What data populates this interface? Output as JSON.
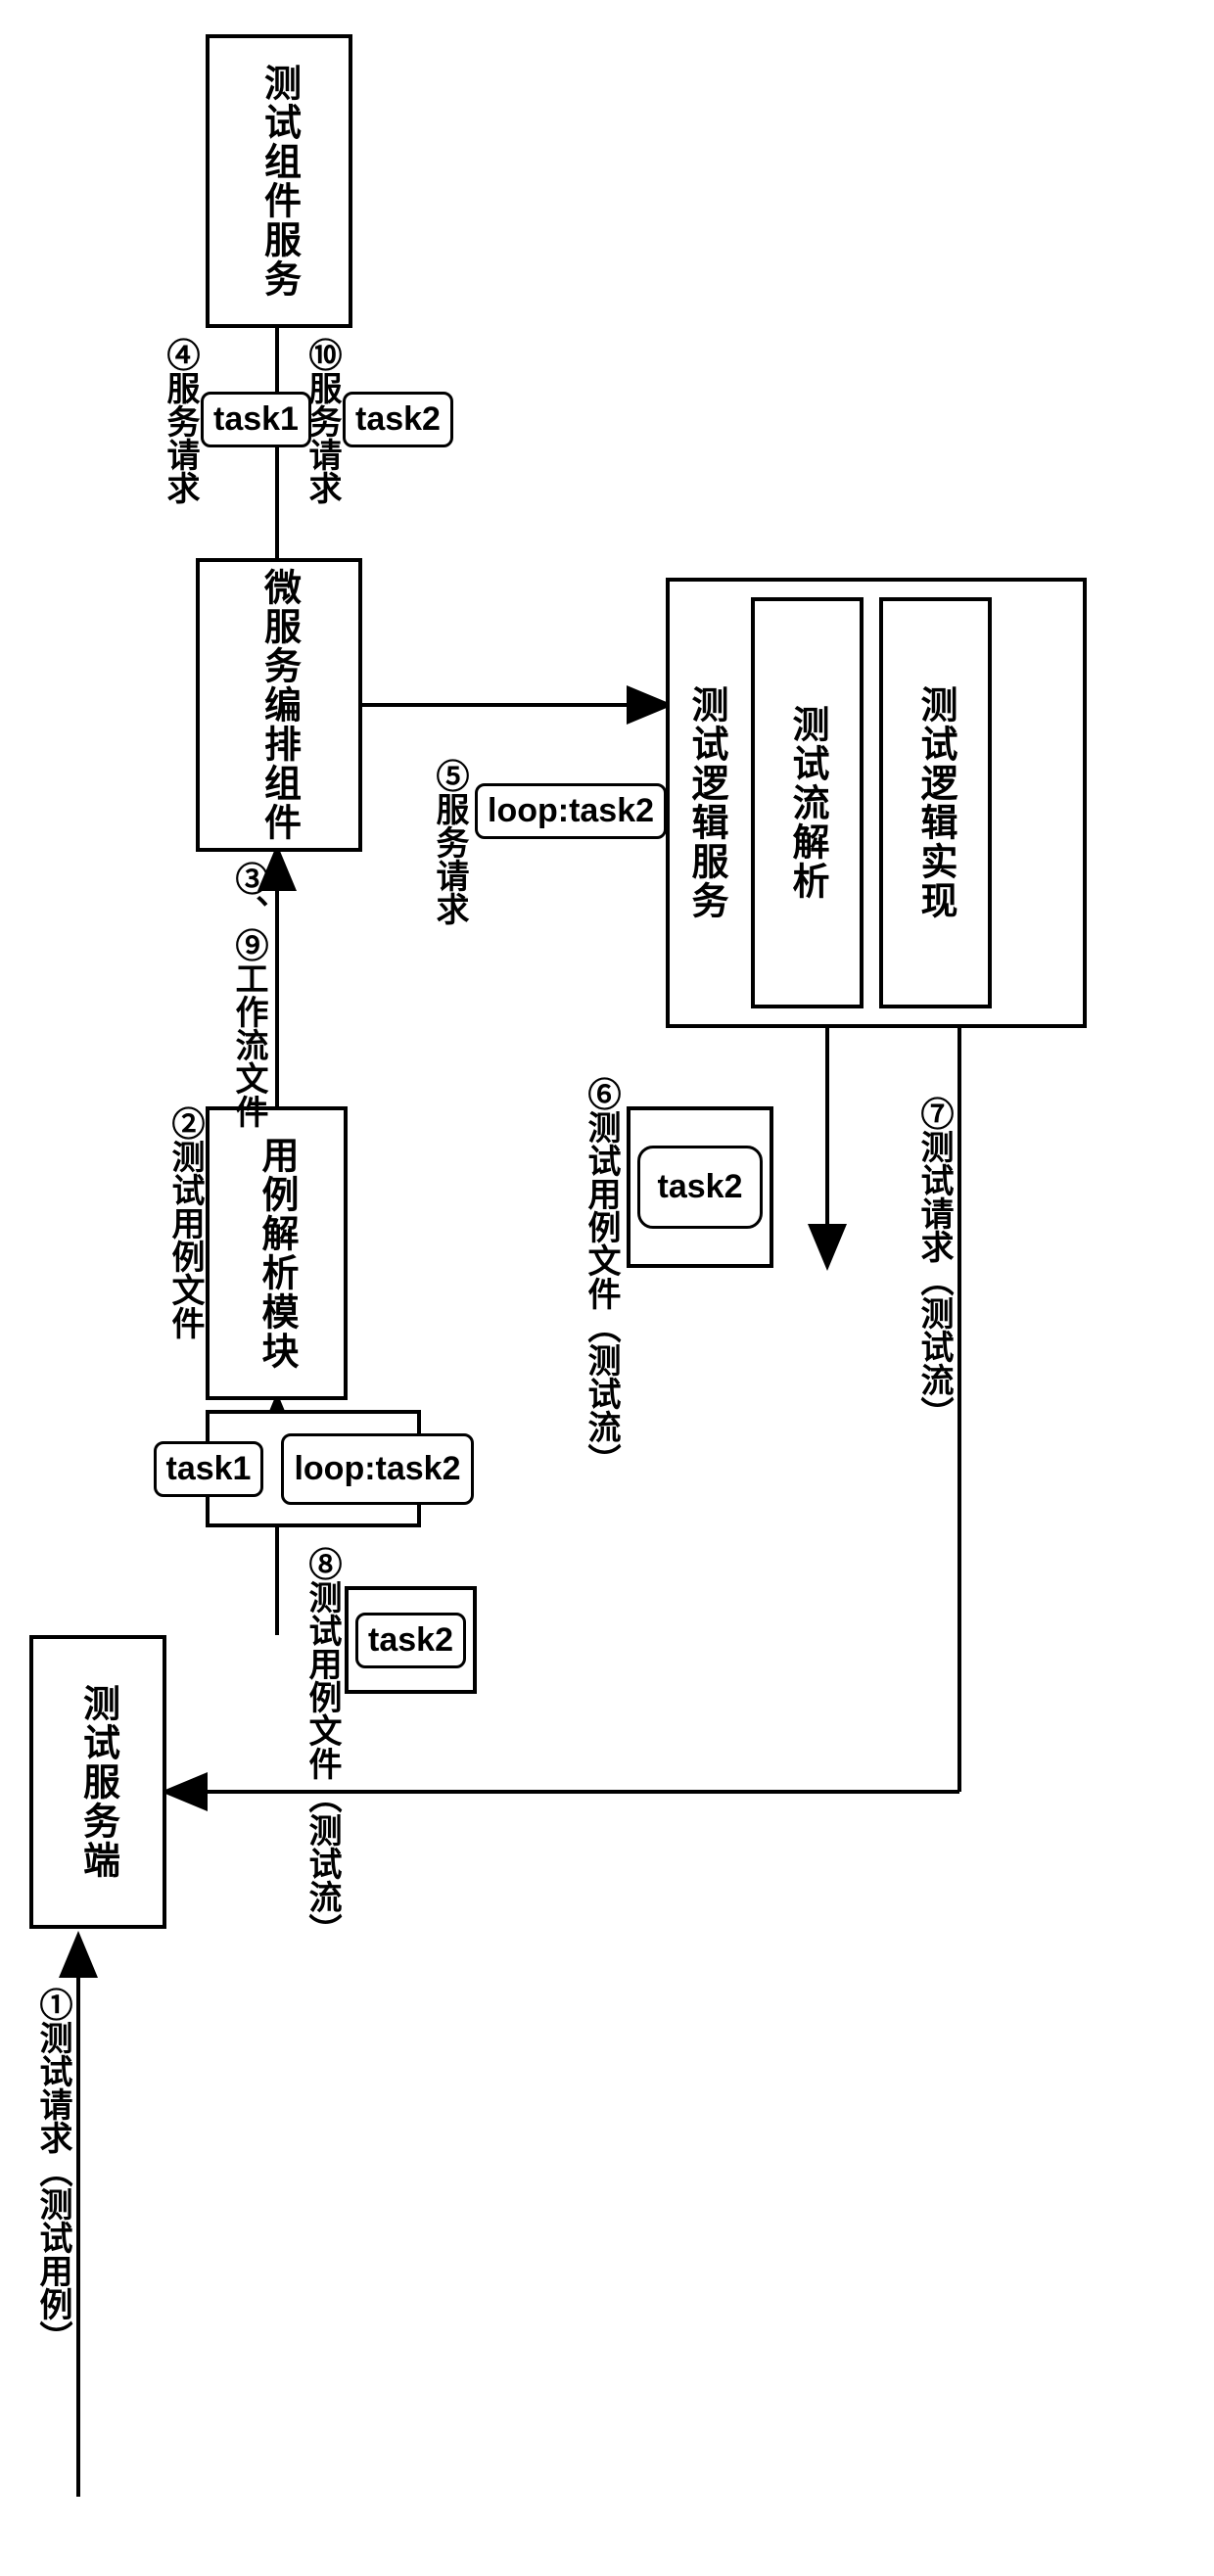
{
  "nodes": {
    "test_server": "测试服务端",
    "case_parser": "用例解析模块",
    "orchestration": "微服务编排组件",
    "test_component_service": "测试组件服务",
    "test_logic_service": "测试逻辑服务",
    "test_flow_parse": "测试流解析",
    "test_logic_impl": "测试逻辑实现"
  },
  "labels": {
    "step1": "①测试请求（测试用例）",
    "step2": "②测试用例文件",
    "step3_9": "③、⑨工作流文件",
    "step4": "④服务请求",
    "step5": "⑤服务请求",
    "step6": "⑥测试用例文件（测试流）",
    "step7": "⑦测试请求（测试流）",
    "step8": "⑧测试用例文件（测试流）",
    "step10": "⑩服务请求"
  },
  "tasks": {
    "task1": "task1",
    "task2": "task2",
    "loop_task2": "loop:task2"
  }
}
